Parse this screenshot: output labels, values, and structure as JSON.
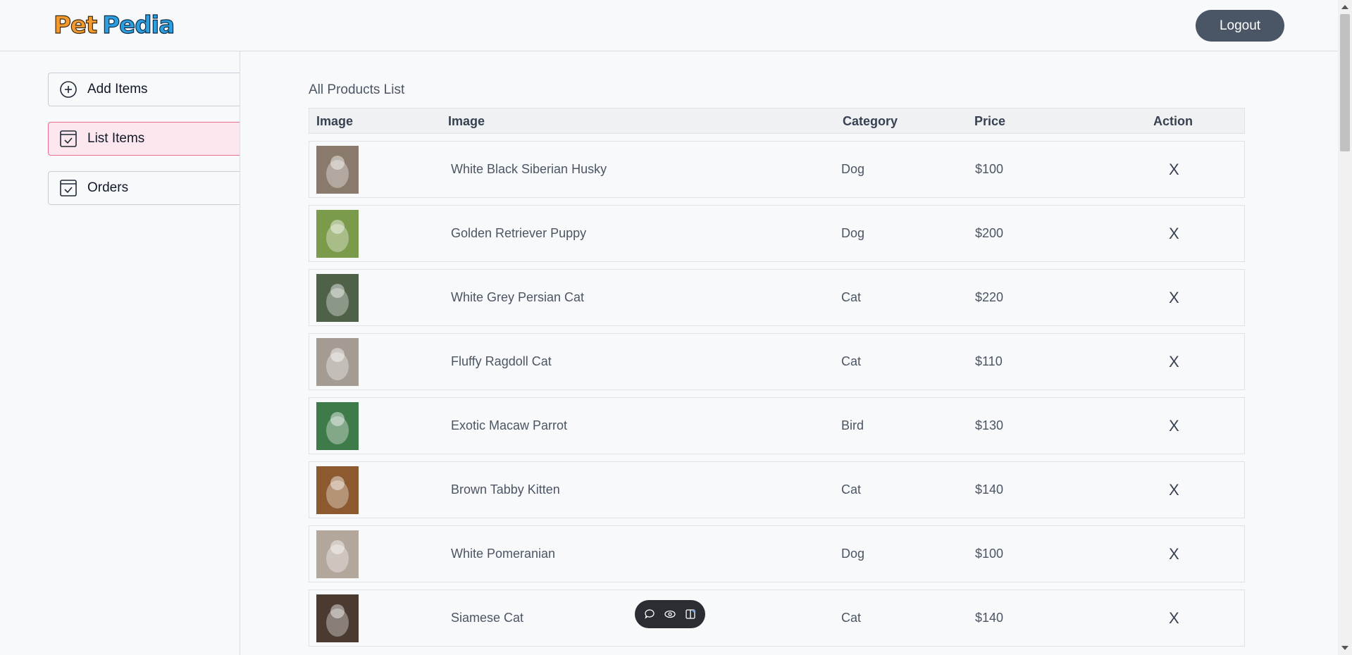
{
  "app": {
    "logo_part1": "Pet",
    "logo_part2": "Pedia"
  },
  "header": {
    "logout_label": "Logout"
  },
  "sidebar": {
    "items": [
      {
        "label": "Add Items",
        "icon": "add-circle-icon"
      },
      {
        "label": "List Items",
        "icon": "checkbox-icon",
        "active": true
      },
      {
        "label": "Orders",
        "icon": "checkbox-icon"
      }
    ]
  },
  "main": {
    "title": "All Products List",
    "columns": [
      "Image",
      "Image",
      "Category",
      "Price",
      "Action"
    ],
    "rows": [
      {
        "name": "White Black Siberian Husky",
        "category": "Dog",
        "price": "$100",
        "action": "X",
        "thumb_color": "#8a7a6c"
      },
      {
        "name": "Golden Retriever Puppy",
        "category": "Dog",
        "price": "$200",
        "action": "X",
        "thumb_color": "#7b9a4a"
      },
      {
        "name": "White Grey Persian Cat",
        "category": "Cat",
        "price": "$220",
        "action": "X",
        "thumb_color": "#4f6248"
      },
      {
        "name": "Fluffy Ragdoll Cat",
        "category": "Cat",
        "price": "$110",
        "action": "X",
        "thumb_color": "#a49c92"
      },
      {
        "name": "Exotic Macaw Parrot",
        "category": "Bird",
        "price": "$130",
        "action": "X",
        "thumb_color": "#3f7a4a"
      },
      {
        "name": "Brown Tabby Kitten",
        "category": "Cat",
        "price": "$140",
        "action": "X",
        "thumb_color": "#8c5a2e"
      },
      {
        "name": "White Pomeranian",
        "category": "Dog",
        "price": "$100",
        "action": "X",
        "thumb_color": "#b3a69b"
      },
      {
        "name": "Siamese Cat",
        "category": "Cat",
        "price": "$140",
        "action": "X",
        "thumb_color": "#4a3a30"
      }
    ]
  },
  "floating_toolbar": {
    "icons": [
      "comment-icon",
      "eye-icon",
      "panel-icon"
    ]
  },
  "colors": {
    "active_bg": "#fde7ef",
    "active_border": "#e8708f",
    "logout_bg": "#4a5565"
  }
}
